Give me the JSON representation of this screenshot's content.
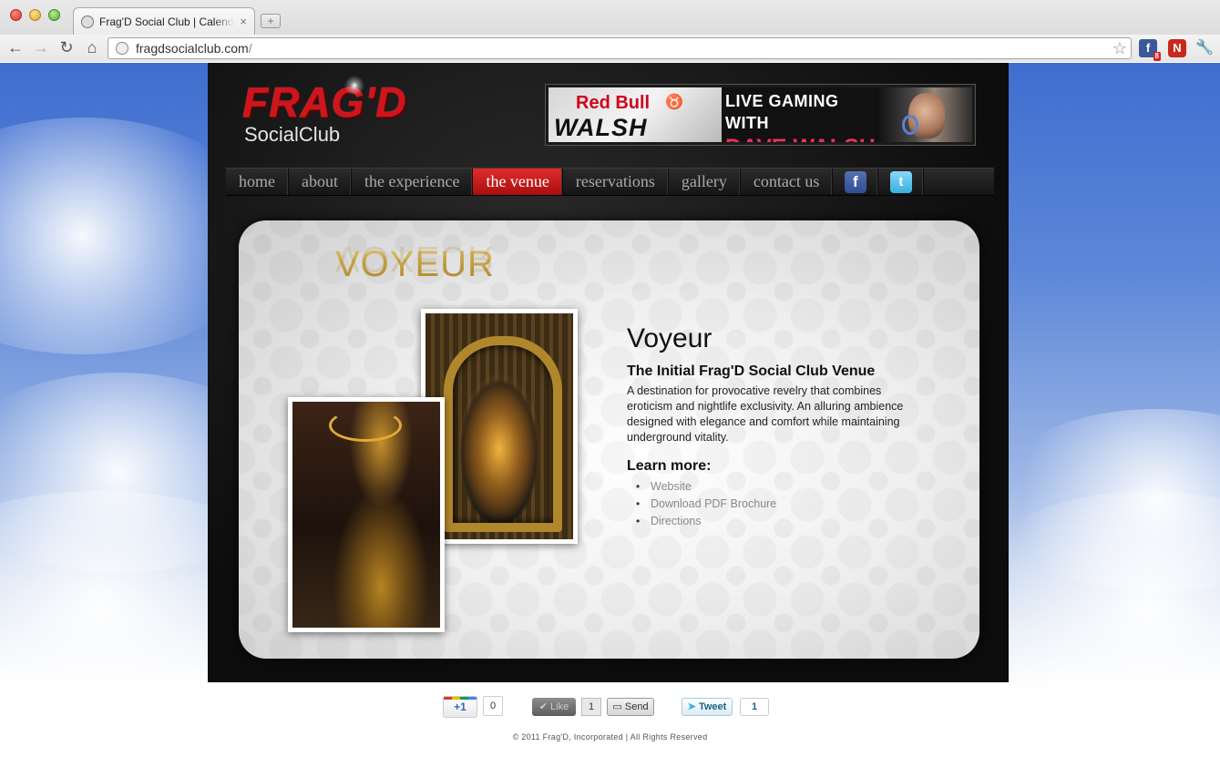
{
  "browser": {
    "tab_title": "Frag'D Social Club | Calendar",
    "tab_close": "×",
    "new_tab": "+",
    "url_host": "fragdsocialclub.com",
    "url_path": "/",
    "back": "←",
    "forward": "→",
    "reload": "↻",
    "home": "⌂",
    "star": "☆",
    "ext_facebook_badge": "8",
    "ext_facebook_letter": "f",
    "ext_n_letter": "N",
    "wrench": "🔧"
  },
  "site": {
    "logo": {
      "top": "FRAG'D",
      "bottom": "SocialClub"
    },
    "banner": {
      "brand": "Red Bull",
      "name_graphic": "WALSH",
      "line1": "LIVE GAMING WITH",
      "line2": "DAVE WALSH"
    },
    "nav": [
      {
        "label": "home",
        "active": false
      },
      {
        "label": "about",
        "active": false
      },
      {
        "label": "the experience",
        "active": false
      },
      {
        "label": "the venue",
        "active": true
      },
      {
        "label": "reservations",
        "active": false
      },
      {
        "label": "gallery",
        "active": false
      },
      {
        "label": "contact us",
        "active": false
      }
    ],
    "social_icons": {
      "facebook": "f",
      "twitter": "t"
    },
    "venue": {
      "heading_graphic": "VOYEUR",
      "title": "Voyeur",
      "subtitle": "The Initial Frag'D Social Club Venue",
      "description": "A destination for provocative revelry that combines eroticism and nightlife exclusivity. An alluring ambience designed with elegance and comfort while maintaining underground vitality.",
      "learn_more": "Learn more:",
      "links": [
        "Website",
        "Download PDF Brochure",
        "Directions"
      ]
    }
  },
  "footer": {
    "gplus_label": "+1",
    "gplus_count": "0",
    "like_label": "✔ Like",
    "like_count": "1",
    "send_label": "Send",
    "tweet_label": "Tweet",
    "tweet_count": "1",
    "copyright": "© 2011 Frag'D, Incorporated  |  All Rights Reserved"
  },
  "colors": {
    "nav_active": "#d3191e",
    "logo_red": "#d0141c",
    "heading_gold": "#c29a3d",
    "banner_pink": "#e8345c"
  }
}
